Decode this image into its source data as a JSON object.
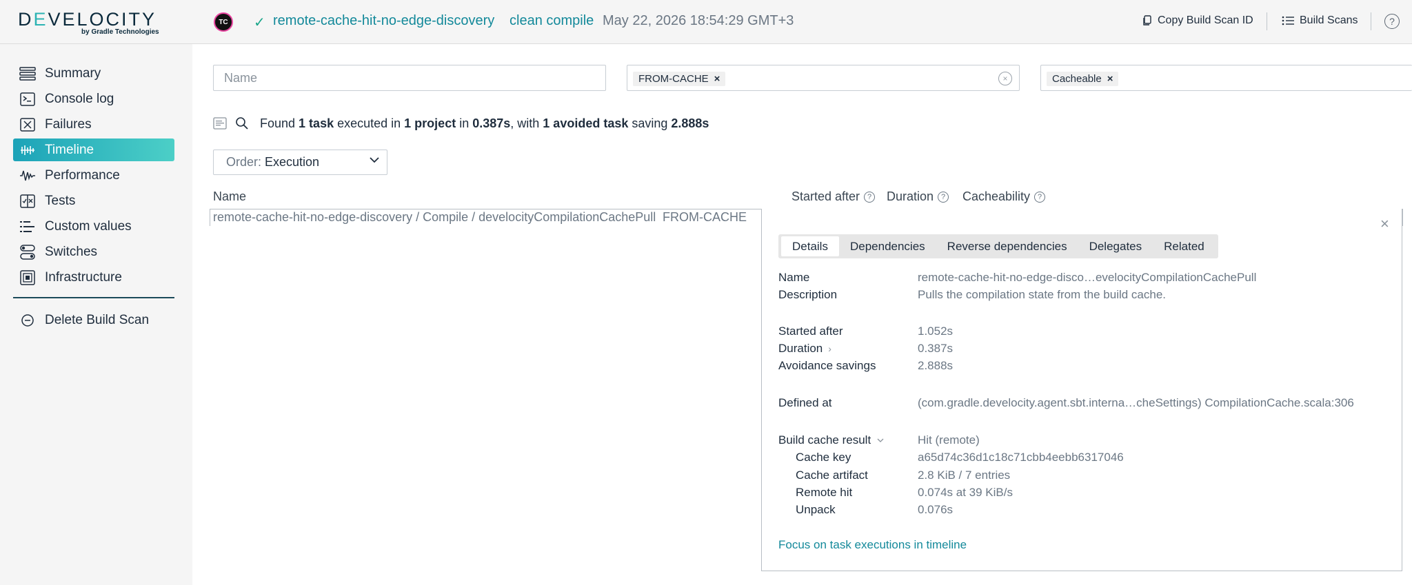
{
  "header": {
    "logo_main_pre": "D",
    "logo_main_accent": "E",
    "logo_main_post": "VELOCITY",
    "logo_sub": "by Gradle Technologies",
    "ci_badge": "TC",
    "project_name": "remote-cache-hit-no-edge-discovery",
    "build_task": "clean compile",
    "build_date": "May 22, 2026 18:54:29 GMT+3",
    "copy_id_label": "Copy Build Scan ID",
    "build_scans_label": "Build Scans",
    "help_glyph": "?"
  },
  "sidebar": {
    "items": [
      {
        "label": "Summary"
      },
      {
        "label": "Console log"
      },
      {
        "label": "Failures"
      },
      {
        "label": "Timeline"
      },
      {
        "label": "Performance"
      },
      {
        "label": "Tests"
      },
      {
        "label": "Custom values"
      },
      {
        "label": "Switches"
      },
      {
        "label": "Infrastructure"
      }
    ],
    "delete_label": "Delete Build Scan"
  },
  "filters": {
    "name_placeholder": "Name",
    "name_value": "",
    "outcome_chip": "FROM-CACHE",
    "cacheability_chip": "Cacheable",
    "chip_remove": "×",
    "clear_glyph": "×"
  },
  "summary": {
    "p1": "Found",
    "n1": "1 task",
    "p2": "executed in",
    "n2": "1 project",
    "p3": "in",
    "n3": "0.387s",
    "p4": ", with",
    "n4": "1 avoided task",
    "p5": "saving",
    "n5": "2.888s"
  },
  "order": {
    "label": "Order:",
    "value": "Execution"
  },
  "columns": {
    "name": "Name",
    "started_after": "Started after",
    "duration": "Duration",
    "cacheability": "Cacheability",
    "help_glyph": "?"
  },
  "task_row": {
    "path": "remote-cache-hit-no-edge-discovery / Compile / develocityCompilationCachePull",
    "outcome": "FROM-CACHE"
  },
  "details": {
    "close_glyph": "×",
    "tabs": [
      "Details",
      "Dependencies",
      "Reverse dependencies",
      "Delegates",
      "Related"
    ],
    "name_label": "Name",
    "name_value": "remote-cache-hit-no-edge-disco…evelocityCompilationCachePull",
    "description_label": "Description",
    "description_value": "Pulls the compilation state from the build cache.",
    "started_after_label": "Started after",
    "started_after_value": "1.052s",
    "duration_label": "Duration",
    "duration_value": "0.387s",
    "avoidance_label": "Avoidance savings",
    "avoidance_value": "2.888s",
    "defined_at_label": "Defined at",
    "defined_at_value": "(com.gradle.develocity.agent.sbt.interna…cheSettings) CompilationCache.scala:306",
    "cache_result_label": "Build cache result",
    "cache_result_value": "Hit (remote)",
    "cache_key_label": "Cache key",
    "cache_key_value": "a65d74c36d1c18c71cbb4eebb6317046",
    "cache_artifact_label": "Cache artifact",
    "cache_artifact_value": "2.8 KiB / 7 entries",
    "remote_hit_label": "Remote hit",
    "remote_hit_value": "0.074s at 39 KiB/s",
    "unpack_label": "Unpack",
    "unpack_value": "0.076s",
    "focus_link": "Focus on task executions in timeline"
  }
}
